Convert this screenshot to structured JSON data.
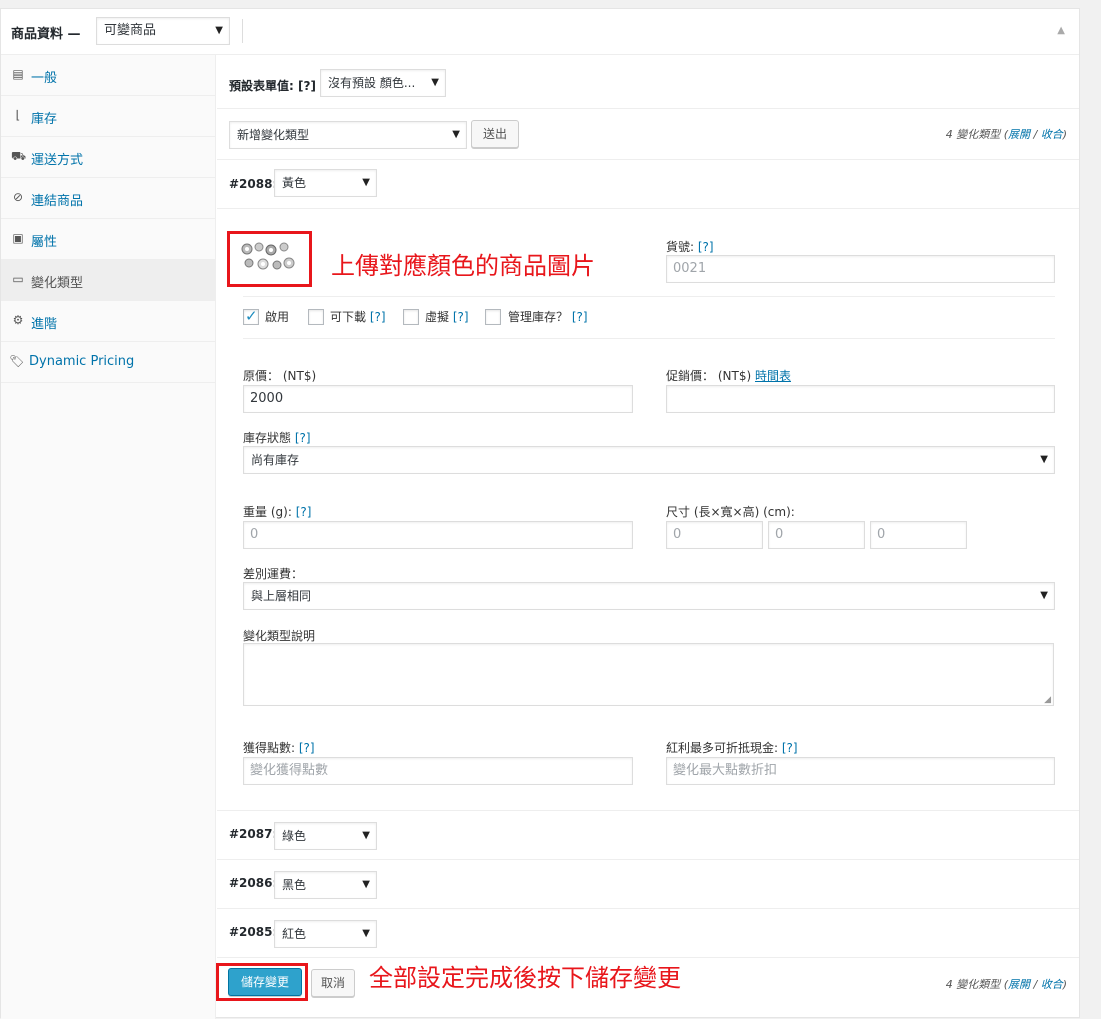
{
  "header": {
    "title": "商品資料 —",
    "product_type": "可變商品"
  },
  "sidebar": {
    "items": [
      {
        "label": "一般",
        "icon": "general-icon"
      },
      {
        "label": "庫存",
        "icon": "inventory-icon"
      },
      {
        "label": "運送方式",
        "icon": "shipping-icon"
      },
      {
        "label": "連結商品",
        "icon": "link-icon"
      },
      {
        "label": "屬性",
        "icon": "attributes-icon"
      },
      {
        "label": "變化類型",
        "icon": "variations-icon"
      },
      {
        "label": "進階",
        "icon": "advanced-icon"
      },
      {
        "label": "Dynamic Pricing",
        "icon": "tag-icon"
      }
    ]
  },
  "defaults": {
    "label": "預設表單值:",
    "help": "[?]",
    "value": "沒有預設 顏色..."
  },
  "add_variation": {
    "select": "新增變化類型",
    "button": "送出",
    "count_text": "4 變化類型 (",
    "expand": "展開",
    "sep": " / ",
    "collapse": "收合",
    "close": ")"
  },
  "variation_2088": {
    "id": "#2088:",
    "color": "黃色",
    "annotation": "上傳對應顏色的商品圖片",
    "sku_label": "貨號:",
    "sku_help": "[?]",
    "sku_placeholder": "0021",
    "enabled": "啟用",
    "downloadable": "可下載",
    "virtual": "虛擬",
    "manage_stock": "管理庫存？",
    "help": "[?]",
    "regular_label": "原價：",
    "regular_currency": "(NT$)",
    "regular_value": "2000",
    "sale_label": "促銷價：",
    "sale_currency": "(NT$)",
    "schedule": "時間表",
    "stock_status_label": "庫存狀態",
    "stock_status": "尚有庫存",
    "weight_label": "重量",
    "weight_unit": "(g):",
    "weight_placeholder": "0",
    "dims_label": "尺寸 (長×寬×高) (cm):",
    "dim_l": "0",
    "dim_w": "0",
    "dim_h": "0",
    "shipping_class_label": "差別運費：",
    "shipping_class": "與上層相同",
    "description_label": "變化類型說明",
    "points_label": "獲得點數:",
    "points_placeholder": "變化獲得點數",
    "max_discount_label": "紅利最多可折抵現金:",
    "max_discount_placeholder": "變化最大點數折扣"
  },
  "variations": [
    {
      "id": "#2087:",
      "color": "綠色"
    },
    {
      "id": "#2086:",
      "color": "黑色"
    },
    {
      "id": "#2085:",
      "color": "紅色"
    }
  ],
  "footer": {
    "save": "儲存變更",
    "cancel": "取消",
    "annotation": "全部設定完成後按下儲存變更",
    "count_text": "4 變化類型 (",
    "expand": "展開",
    "sep": " / ",
    "collapse": "收合",
    "close": ")"
  },
  "colors": {
    "link": "#0073aa",
    "primary_button": "#2ea2cc",
    "annotation": "#e8161b"
  }
}
